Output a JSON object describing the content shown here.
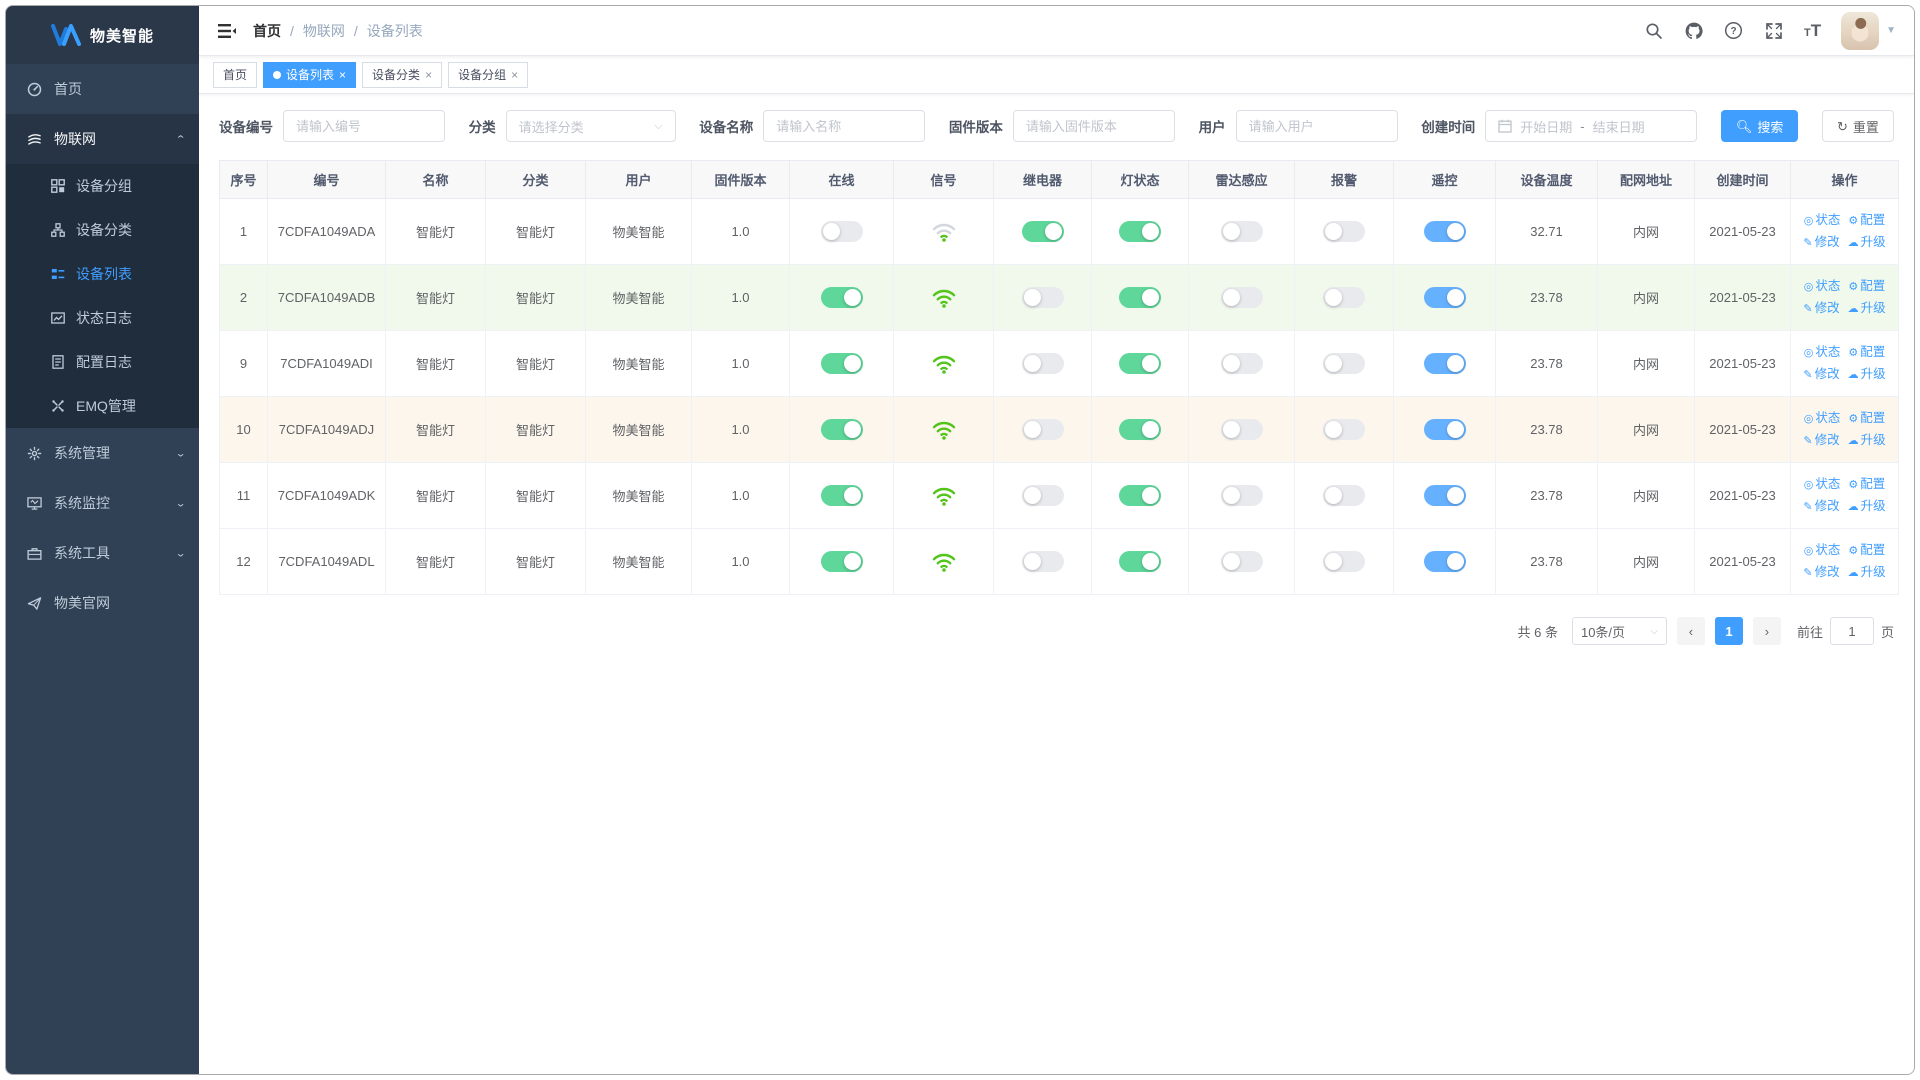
{
  "app": {
    "title": "物美智能"
  },
  "colors": {
    "primary": "#409EFF",
    "sidebar_bg": "#304156",
    "submenu_bg": "#1f2d3d",
    "switch_on_green": "#5fd69a",
    "switch_on_blue": "#66b1ff",
    "switch_off": "#e9eaee",
    "wifi_strong": "#52c41a",
    "wifi_weak_gray": "#d3d6dc",
    "row_success_bg": "#f0f9eb",
    "row_warning_bg": "#fdf6ec"
  },
  "sidebar": {
    "logo_text": "物美智能",
    "home_label": "首页",
    "iot_label": "物联网",
    "iot_children": {
      "group": "设备分组",
      "category": "设备分类",
      "list": "设备列表",
      "status_log": "状态日志",
      "config_log": "配置日志",
      "emq": "EMQ管理"
    },
    "system_manage": "系统管理",
    "system_monitor": "系统监控",
    "system_tools": "系统工具",
    "official_site": "物美官网"
  },
  "topbar": {
    "breadcrumb": [
      "首页",
      "物联网",
      "设备列表"
    ]
  },
  "tags": [
    {
      "label": "首页",
      "active": false,
      "closable": false
    },
    {
      "label": "设备列表",
      "active": true,
      "closable": true
    },
    {
      "label": "设备分类",
      "active": false,
      "closable": true
    },
    {
      "label": "设备分组",
      "active": false,
      "closable": true
    }
  ],
  "filters": {
    "device_no_label": "设备编号",
    "device_no_placeholder": "请输入编号",
    "category_label": "分类",
    "category_placeholder": "请选择分类",
    "name_label": "设备名称",
    "name_placeholder": "请输入名称",
    "firmware_label": "固件版本",
    "firmware_placeholder": "请输入固件版本",
    "user_label": "用户",
    "user_placeholder": "请输入用户",
    "created_label": "创建时间",
    "date_start_placeholder": "开始日期",
    "date_separator": "-",
    "date_end_placeholder": "结束日期",
    "search_label": "搜索",
    "reset_label": "重置"
  },
  "table": {
    "headers": [
      "序号",
      "编号",
      "名称",
      "分类",
      "用户",
      "固件版本",
      "在线",
      "信号",
      "继电器",
      "灯状态",
      "雷达感应",
      "报警",
      "遥控",
      "设备温度",
      "配网地址",
      "创建时间",
      "操作"
    ],
    "actions": {
      "status": "状态",
      "config": "配置",
      "edit": "修改",
      "upgrade": "升级"
    },
    "rows": [
      {
        "index": "1",
        "code": "7CDFA1049ADA",
        "name": "智能灯",
        "category": "智能灯",
        "user": "物美智能",
        "firmware": "1.0",
        "online": false,
        "signal": "weak",
        "relay": true,
        "light": true,
        "radar": false,
        "alarm": false,
        "remote": true,
        "temperature": "32.71",
        "network": "内网",
        "created": "2021-05-23",
        "row_bg": "default"
      },
      {
        "index": "2",
        "code": "7CDFA1049ADB",
        "name": "智能灯",
        "category": "智能灯",
        "user": "物美智能",
        "firmware": "1.0",
        "online": true,
        "signal": "strong",
        "relay": false,
        "light": true,
        "radar": false,
        "alarm": false,
        "remote": true,
        "temperature": "23.78",
        "network": "内网",
        "created": "2021-05-23",
        "row_bg": "success"
      },
      {
        "index": "9",
        "code": "7CDFA1049ADI",
        "name": "智能灯",
        "category": "智能灯",
        "user": "物美智能",
        "firmware": "1.0",
        "online": true,
        "signal": "strong",
        "relay": false,
        "light": true,
        "radar": false,
        "alarm": false,
        "remote": true,
        "temperature": "23.78",
        "network": "内网",
        "created": "2021-05-23",
        "row_bg": "default"
      },
      {
        "index": "10",
        "code": "7CDFA1049ADJ",
        "name": "智能灯",
        "category": "智能灯",
        "user": "物美智能",
        "firmware": "1.0",
        "online": true,
        "signal": "strong",
        "relay": false,
        "light": true,
        "radar": false,
        "alarm": false,
        "remote": true,
        "temperature": "23.78",
        "network": "内网",
        "created": "2021-05-23",
        "row_bg": "warning"
      },
      {
        "index": "11",
        "code": "7CDFA1049ADK",
        "name": "智能灯",
        "category": "智能灯",
        "user": "物美智能",
        "firmware": "1.0",
        "online": true,
        "signal": "strong",
        "relay": false,
        "light": true,
        "radar": false,
        "alarm": false,
        "remote": true,
        "temperature": "23.78",
        "network": "内网",
        "created": "2021-05-23",
        "row_bg": "default"
      },
      {
        "index": "12",
        "code": "7CDFA1049ADL",
        "name": "智能灯",
        "category": "智能灯",
        "user": "物美智能",
        "firmware": "1.0",
        "online": true,
        "signal": "strong",
        "relay": false,
        "light": true,
        "radar": false,
        "alarm": false,
        "remote": true,
        "temperature": "23.78",
        "network": "内网",
        "created": "2021-05-23",
        "row_bg": "default"
      }
    ]
  },
  "pagination": {
    "total_text": "共 6 条",
    "page_size": "10条/页",
    "current_page": "1",
    "goto_label": "前往",
    "goto_value": "1",
    "page_suffix": "页"
  }
}
